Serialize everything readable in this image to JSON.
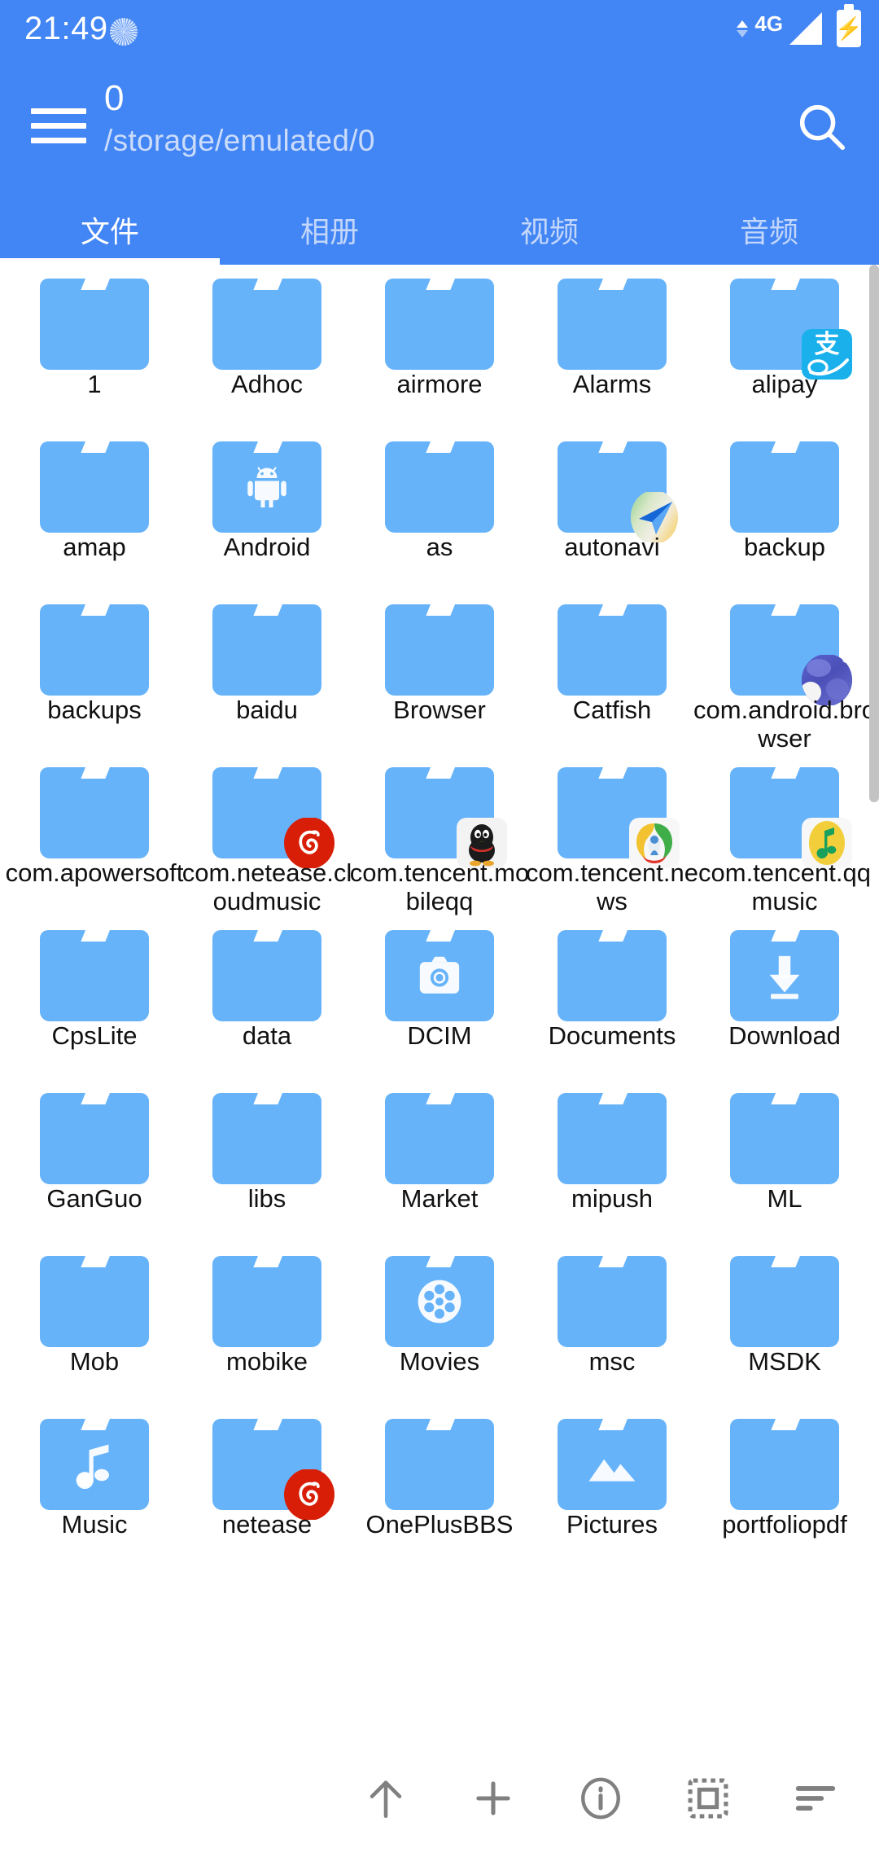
{
  "statusbar": {
    "time": "21:49",
    "spinner_icon": "loading-spinner-icon",
    "network_type": "4G",
    "signal_icon": "signal-bars-icon",
    "battery_icon": "battery-charging-icon",
    "data_arrows_icon": "data-transfer-arrows-icon"
  },
  "appbar": {
    "menu_icon": "hamburger-menu-icon",
    "title": "0",
    "path": "/storage/emulated/0",
    "search_icon": "search-icon"
  },
  "tabs": [
    {
      "label": "文件",
      "active": true
    },
    {
      "label": "相册",
      "active": false
    },
    {
      "label": "视频",
      "active": false
    },
    {
      "label": "音频",
      "active": false
    }
  ],
  "colors": {
    "header_blue": "#4285f4",
    "folder_blue": "#66b3fa",
    "tab_inactive": "#c3d7fb",
    "label_text": "#111111",
    "toolbar_icon": "#808080",
    "scrollbar": "#c3c3c3"
  },
  "files": [
    {
      "name": "1",
      "type": "folder",
      "glyph": null,
      "badge": null
    },
    {
      "name": "Adhoc",
      "type": "folder",
      "glyph": null,
      "badge": null
    },
    {
      "name": "airmore",
      "type": "folder",
      "glyph": null,
      "badge": null
    },
    {
      "name": "Alarms",
      "type": "folder",
      "glyph": null,
      "badge": null
    },
    {
      "name": "alipay",
      "type": "folder",
      "glyph": null,
      "badge": "alipay-icon"
    },
    {
      "name": "amap",
      "type": "folder",
      "glyph": null,
      "badge": null
    },
    {
      "name": "Android",
      "type": "folder",
      "glyph": "android-icon",
      "badge": null
    },
    {
      "name": "as",
      "type": "folder",
      "glyph": null,
      "badge": null
    },
    {
      "name": "autonavi",
      "type": "folder",
      "glyph": null,
      "badge": "autonavi-map-icon"
    },
    {
      "name": "backup",
      "type": "folder",
      "glyph": null,
      "badge": null
    },
    {
      "name": "backups",
      "type": "folder",
      "glyph": null,
      "badge": null
    },
    {
      "name": "baidu",
      "type": "folder",
      "glyph": null,
      "badge": null
    },
    {
      "name": "Browser",
      "type": "folder",
      "glyph": null,
      "badge": null
    },
    {
      "name": "Catfish",
      "type": "folder",
      "glyph": null,
      "badge": null
    },
    {
      "name": "com.android.browser",
      "type": "folder",
      "glyph": null,
      "badge": "browser-globe-icon"
    },
    {
      "name": "com.apowersoft",
      "type": "folder",
      "glyph": null,
      "badge": null
    },
    {
      "name": "com.netease.cloudmusic",
      "type": "folder",
      "glyph": null,
      "badge": "netease-music-icon"
    },
    {
      "name": "com.tencent.mobileqq",
      "type": "folder",
      "glyph": null,
      "badge": "qq-penguin-icon"
    },
    {
      "name": "com.tencent.news",
      "type": "folder",
      "glyph": null,
      "badge": "tencent-news-icon"
    },
    {
      "name": "com.tencent.qqmusic",
      "type": "folder",
      "glyph": null,
      "badge": "qq-music-icon"
    },
    {
      "name": "CpsLite",
      "type": "folder",
      "glyph": null,
      "badge": null
    },
    {
      "name": "data",
      "type": "folder",
      "glyph": null,
      "badge": null
    },
    {
      "name": "DCIM",
      "type": "folder",
      "glyph": "camera-icon",
      "badge": null
    },
    {
      "name": "Documents",
      "type": "folder",
      "glyph": null,
      "badge": null
    },
    {
      "name": "Download",
      "type": "folder",
      "glyph": "download-icon",
      "badge": null
    },
    {
      "name": "GanGuo",
      "type": "folder",
      "glyph": null,
      "badge": null
    },
    {
      "name": "libs",
      "type": "folder",
      "glyph": null,
      "badge": null
    },
    {
      "name": "Market",
      "type": "folder",
      "glyph": null,
      "badge": null
    },
    {
      "name": "mipush",
      "type": "folder",
      "glyph": null,
      "badge": null
    },
    {
      "name": "ML",
      "type": "folder",
      "glyph": null,
      "badge": null
    },
    {
      "name": "Mob",
      "type": "folder",
      "glyph": null,
      "badge": null
    },
    {
      "name": "mobike",
      "type": "folder",
      "glyph": null,
      "badge": null
    },
    {
      "name": "Movies",
      "type": "folder",
      "glyph": "film-reel-icon",
      "badge": null
    },
    {
      "name": "msc",
      "type": "folder",
      "glyph": null,
      "badge": null
    },
    {
      "name": "MSDK",
      "type": "folder",
      "glyph": null,
      "badge": null
    },
    {
      "name": "Music",
      "type": "folder",
      "glyph": "music-note-icon",
      "badge": null
    },
    {
      "name": "netease",
      "type": "folder",
      "glyph": null,
      "badge": "netease-music-icon"
    },
    {
      "name": "OnePlusBBS",
      "type": "folder",
      "glyph": null,
      "badge": null
    },
    {
      "name": "Pictures",
      "type": "folder",
      "glyph": "mountain-image-icon",
      "badge": null
    },
    {
      "name": "portfoliopdf",
      "type": "folder",
      "glyph": null,
      "badge": null
    }
  ],
  "bottom_toolbar": [
    {
      "icon": "arrow-up-icon",
      "name": "parent-directory-button"
    },
    {
      "icon": "plus-icon",
      "name": "new-item-button"
    },
    {
      "icon": "info-icon",
      "name": "info-button"
    },
    {
      "icon": "select-all-icon",
      "name": "select-all-button"
    },
    {
      "icon": "sort-icon",
      "name": "sort-button"
    }
  ]
}
